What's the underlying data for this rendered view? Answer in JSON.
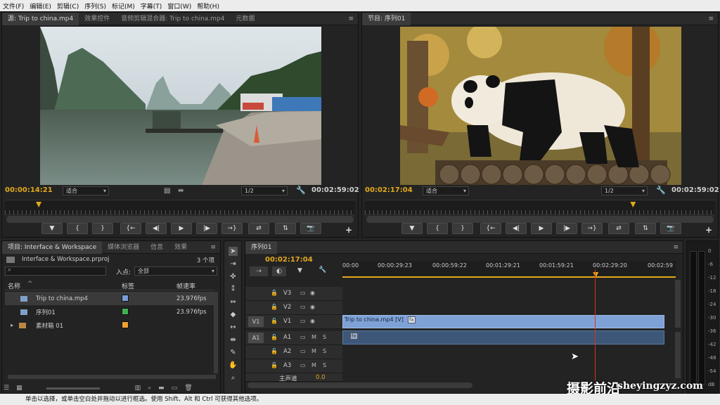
{
  "menu": [
    "文件(F)",
    "编辑(E)",
    "剪辑(C)",
    "序列(S)",
    "标记(M)",
    "字幕(T)",
    "窗口(W)",
    "帮助(H)"
  ],
  "source": {
    "tabs": [
      "源: Trip to china.mp4",
      "效果控件",
      "音频剪辑混合器: Trip to china.mp4",
      "元数据"
    ],
    "timecode": "00:00:14:21",
    "fit": "适合",
    "resolution": "1/2",
    "duration": "00:02:59:02",
    "playhead_fraction": 0.09
  },
  "program": {
    "tab": "节目: 序列01",
    "timecode": "00:02:17:04",
    "fit": "适合",
    "resolution": "1/2",
    "duration": "00:02:59:02",
    "playhead_fraction": 0.77
  },
  "controls": [
    "▼",
    "{",
    "}",
    "{←",
    "◀|",
    "▶",
    "|▶",
    "→}",
    "⇄",
    "⇅",
    "📷"
  ],
  "project": {
    "tabs": [
      "项目: Interface & Workspace",
      "媒体浏览器",
      "信息",
      "效果"
    ],
    "filename": "Interface & Workspace.prproj",
    "count": "3 个项",
    "search_placeholder": "",
    "in_label": "入点:",
    "in_value": "全部",
    "columns": {
      "name": "名称",
      "label": "标签",
      "fps": "帧速率"
    },
    "items": [
      {
        "name": "Trip to china.mp4",
        "fps": "23.976fps",
        "color": "#7b9bd6"
      },
      {
        "name": "序列01",
        "fps": "23.976fps",
        "color": "#3fb052"
      },
      {
        "name": "素材箱 01",
        "fps": "",
        "color": "#f0a030"
      }
    ]
  },
  "timeline": {
    "tab": "序列01",
    "timecode": "00:02:17:04",
    "ruler": [
      "00:00",
      "00:00:29:23",
      "00:00:59:22",
      "00:01:29:21",
      "00:01:59:21",
      "00:02:29:20",
      "00:02:59"
    ],
    "video_tracks": [
      "V3",
      "V2",
      "V1"
    ],
    "audio_tracks": [
      "A1",
      "A2",
      "A3"
    ],
    "master": "主声道",
    "master_value": "0.0",
    "source_patch_v": "V1",
    "source_patch_a": "A1",
    "clip_label": "Trip to china.mp4 [V]",
    "playhead_fraction": 0.76
  },
  "meter": {
    "scale": [
      "0",
      "-6",
      "-12",
      "-18",
      "-24",
      "-30",
      "-36",
      "-42",
      "-48",
      "-54",
      "dB"
    ]
  },
  "status": "单击以选择，或单击空白处并拖动以进行框选。使用 Shift、Alt 和 Ctrl 可获得其他选项。",
  "watermark": {
    "text": "摄影前沿",
    "url": "sheyingzyz.com"
  }
}
